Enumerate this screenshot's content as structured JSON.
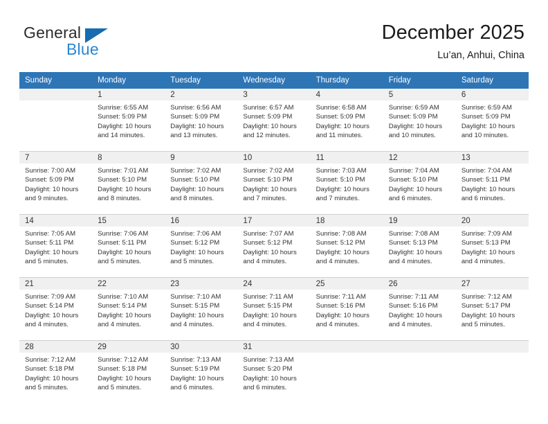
{
  "brand": {
    "name_part1": "General",
    "name_part2": "Blue",
    "accent_color": "#2a87d0",
    "triangle_color": "#156cb0"
  },
  "header": {
    "title": "December 2025",
    "subtitle": "Lu’an, Anhui, China"
  },
  "theme": {
    "header_row_bg": "#2e75b6",
    "daynum_strip_bg": "#f0f0f0",
    "grid_line": "#cfcfcf",
    "text": "#333333"
  },
  "weekdays": [
    "Sunday",
    "Monday",
    "Tuesday",
    "Wednesday",
    "Thursday",
    "Friday",
    "Saturday"
  ],
  "weeks": [
    [
      {
        "day": "",
        "sunrise": "",
        "sunset": "",
        "daylight1": "",
        "daylight2": ""
      },
      {
        "day": "1",
        "sunrise": "Sunrise: 6:55 AM",
        "sunset": "Sunset: 5:09 PM",
        "daylight1": "Daylight: 10 hours",
        "daylight2": "and 14 minutes."
      },
      {
        "day": "2",
        "sunrise": "Sunrise: 6:56 AM",
        "sunset": "Sunset: 5:09 PM",
        "daylight1": "Daylight: 10 hours",
        "daylight2": "and 13 minutes."
      },
      {
        "day": "3",
        "sunrise": "Sunrise: 6:57 AM",
        "sunset": "Sunset: 5:09 PM",
        "daylight1": "Daylight: 10 hours",
        "daylight2": "and 12 minutes."
      },
      {
        "day": "4",
        "sunrise": "Sunrise: 6:58 AM",
        "sunset": "Sunset: 5:09 PM",
        "daylight1": "Daylight: 10 hours",
        "daylight2": "and 11 minutes."
      },
      {
        "day": "5",
        "sunrise": "Sunrise: 6:59 AM",
        "sunset": "Sunset: 5:09 PM",
        "daylight1": "Daylight: 10 hours",
        "daylight2": "and 10 minutes."
      },
      {
        "day": "6",
        "sunrise": "Sunrise: 6:59 AM",
        "sunset": "Sunset: 5:09 PM",
        "daylight1": "Daylight: 10 hours",
        "daylight2": "and 10 minutes."
      }
    ],
    [
      {
        "day": "7",
        "sunrise": "Sunrise: 7:00 AM",
        "sunset": "Sunset: 5:09 PM",
        "daylight1": "Daylight: 10 hours",
        "daylight2": "and 9 minutes."
      },
      {
        "day": "8",
        "sunrise": "Sunrise: 7:01 AM",
        "sunset": "Sunset: 5:10 PM",
        "daylight1": "Daylight: 10 hours",
        "daylight2": "and 8 minutes."
      },
      {
        "day": "9",
        "sunrise": "Sunrise: 7:02 AM",
        "sunset": "Sunset: 5:10 PM",
        "daylight1": "Daylight: 10 hours",
        "daylight2": "and 8 minutes."
      },
      {
        "day": "10",
        "sunrise": "Sunrise: 7:02 AM",
        "sunset": "Sunset: 5:10 PM",
        "daylight1": "Daylight: 10 hours",
        "daylight2": "and 7 minutes."
      },
      {
        "day": "11",
        "sunrise": "Sunrise: 7:03 AM",
        "sunset": "Sunset: 5:10 PM",
        "daylight1": "Daylight: 10 hours",
        "daylight2": "and 7 minutes."
      },
      {
        "day": "12",
        "sunrise": "Sunrise: 7:04 AM",
        "sunset": "Sunset: 5:10 PM",
        "daylight1": "Daylight: 10 hours",
        "daylight2": "and 6 minutes."
      },
      {
        "day": "13",
        "sunrise": "Sunrise: 7:04 AM",
        "sunset": "Sunset: 5:11 PM",
        "daylight1": "Daylight: 10 hours",
        "daylight2": "and 6 minutes."
      }
    ],
    [
      {
        "day": "14",
        "sunrise": "Sunrise: 7:05 AM",
        "sunset": "Sunset: 5:11 PM",
        "daylight1": "Daylight: 10 hours",
        "daylight2": "and 5 minutes."
      },
      {
        "day": "15",
        "sunrise": "Sunrise: 7:06 AM",
        "sunset": "Sunset: 5:11 PM",
        "daylight1": "Daylight: 10 hours",
        "daylight2": "and 5 minutes."
      },
      {
        "day": "16",
        "sunrise": "Sunrise: 7:06 AM",
        "sunset": "Sunset: 5:12 PM",
        "daylight1": "Daylight: 10 hours",
        "daylight2": "and 5 minutes."
      },
      {
        "day": "17",
        "sunrise": "Sunrise: 7:07 AM",
        "sunset": "Sunset: 5:12 PM",
        "daylight1": "Daylight: 10 hours",
        "daylight2": "and 4 minutes."
      },
      {
        "day": "18",
        "sunrise": "Sunrise: 7:08 AM",
        "sunset": "Sunset: 5:12 PM",
        "daylight1": "Daylight: 10 hours",
        "daylight2": "and 4 minutes."
      },
      {
        "day": "19",
        "sunrise": "Sunrise: 7:08 AM",
        "sunset": "Sunset: 5:13 PM",
        "daylight1": "Daylight: 10 hours",
        "daylight2": "and 4 minutes."
      },
      {
        "day": "20",
        "sunrise": "Sunrise: 7:09 AM",
        "sunset": "Sunset: 5:13 PM",
        "daylight1": "Daylight: 10 hours",
        "daylight2": "and 4 minutes."
      }
    ],
    [
      {
        "day": "21",
        "sunrise": "Sunrise: 7:09 AM",
        "sunset": "Sunset: 5:14 PM",
        "daylight1": "Daylight: 10 hours",
        "daylight2": "and 4 minutes."
      },
      {
        "day": "22",
        "sunrise": "Sunrise: 7:10 AM",
        "sunset": "Sunset: 5:14 PM",
        "daylight1": "Daylight: 10 hours",
        "daylight2": "and 4 minutes."
      },
      {
        "day": "23",
        "sunrise": "Sunrise: 7:10 AM",
        "sunset": "Sunset: 5:15 PM",
        "daylight1": "Daylight: 10 hours",
        "daylight2": "and 4 minutes."
      },
      {
        "day": "24",
        "sunrise": "Sunrise: 7:11 AM",
        "sunset": "Sunset: 5:15 PM",
        "daylight1": "Daylight: 10 hours",
        "daylight2": "and 4 minutes."
      },
      {
        "day": "25",
        "sunrise": "Sunrise: 7:11 AM",
        "sunset": "Sunset: 5:16 PM",
        "daylight1": "Daylight: 10 hours",
        "daylight2": "and 4 minutes."
      },
      {
        "day": "26",
        "sunrise": "Sunrise: 7:11 AM",
        "sunset": "Sunset: 5:16 PM",
        "daylight1": "Daylight: 10 hours",
        "daylight2": "and 4 minutes."
      },
      {
        "day": "27",
        "sunrise": "Sunrise: 7:12 AM",
        "sunset": "Sunset: 5:17 PM",
        "daylight1": "Daylight: 10 hours",
        "daylight2": "and 5 minutes."
      }
    ],
    [
      {
        "day": "28",
        "sunrise": "Sunrise: 7:12 AM",
        "sunset": "Sunset: 5:18 PM",
        "daylight1": "Daylight: 10 hours",
        "daylight2": "and 5 minutes."
      },
      {
        "day": "29",
        "sunrise": "Sunrise: 7:12 AM",
        "sunset": "Sunset: 5:18 PM",
        "daylight1": "Daylight: 10 hours",
        "daylight2": "and 5 minutes."
      },
      {
        "day": "30",
        "sunrise": "Sunrise: 7:13 AM",
        "sunset": "Sunset: 5:19 PM",
        "daylight1": "Daylight: 10 hours",
        "daylight2": "and 6 minutes."
      },
      {
        "day": "31",
        "sunrise": "Sunrise: 7:13 AM",
        "sunset": "Sunset: 5:20 PM",
        "daylight1": "Daylight: 10 hours",
        "daylight2": "and 6 minutes."
      },
      {
        "day": "",
        "sunrise": "",
        "sunset": "",
        "daylight1": "",
        "daylight2": ""
      },
      {
        "day": "",
        "sunrise": "",
        "sunset": "",
        "daylight1": "",
        "daylight2": ""
      },
      {
        "day": "",
        "sunrise": "",
        "sunset": "",
        "daylight1": "",
        "daylight2": ""
      }
    ]
  ]
}
